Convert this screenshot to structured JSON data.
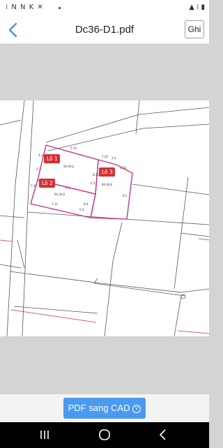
{
  "status_bar": {
    "left_icons": "⁞ N N K ✕",
    "right_icons": "▲ ⁞ ▮"
  },
  "header": {
    "title": "Dc36-D1.pdf",
    "save_label": "Ghi"
  },
  "drawing": {
    "lots": [
      {
        "label": "Lô 1",
        "area": "90.0m2"
      },
      {
        "label": "Lô 2",
        "area": "94.3m2"
      },
      {
        "label": "Lô 3",
        "area": "80.0m2"
      }
    ],
    "dims": [
      "4.2",
      "5.74",
      "5.7",
      "8.35",
      "7.20",
      "2.0",
      "2.20",
      "9.1",
      "7.51",
      "8.9",
      "7.11",
      "5.0",
      "9.1",
      "4.3"
    ]
  },
  "footer": {
    "convert_label": "PDF sang CAD"
  }
}
